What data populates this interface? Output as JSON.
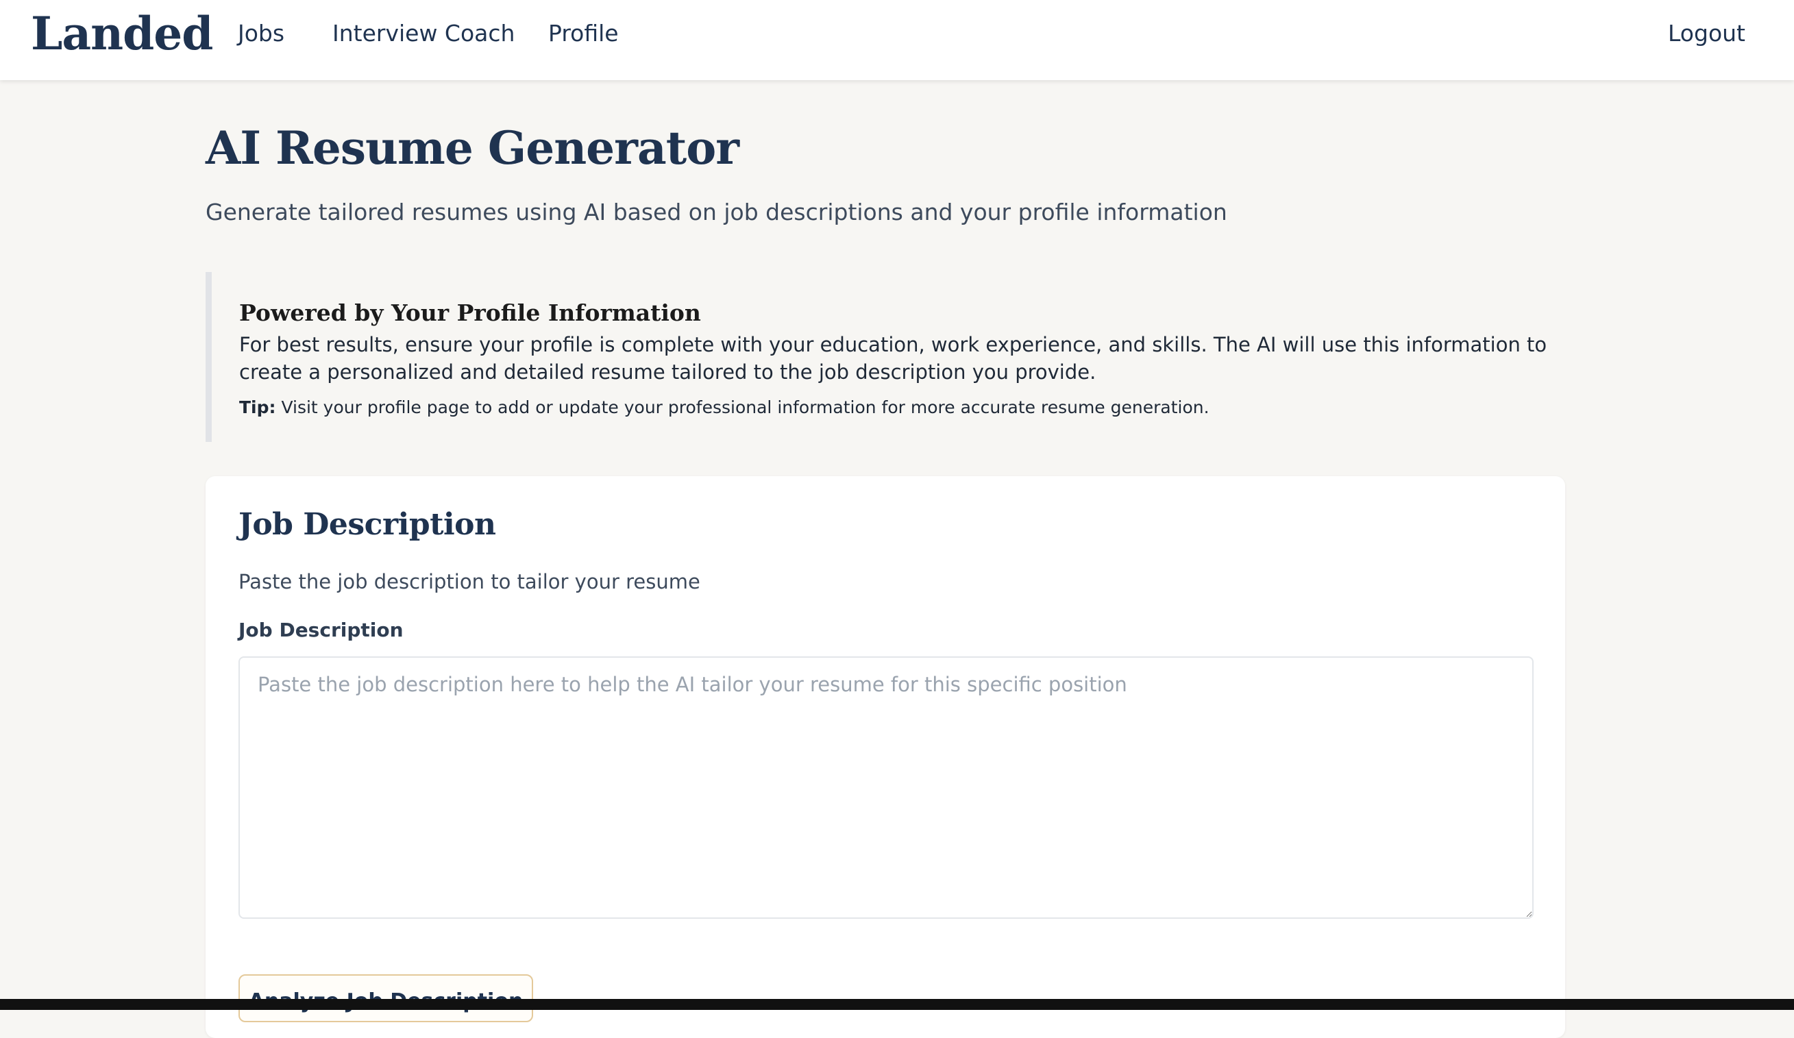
{
  "brand": {
    "logo": "Landed"
  },
  "nav": {
    "links": [
      "Jobs",
      "Interview Coach",
      "Profile"
    ],
    "logout": "Logout"
  },
  "page": {
    "title": "AI Resume Generator",
    "subtitle": "Generate tailored resumes using AI based on job descriptions and your profile information"
  },
  "info": {
    "title": "Powered by Your Profile Information",
    "text": "For best results, ensure your profile is complete with your education, work experience, and skills. The AI will use this information to create a personalized and detailed resume tailored to the job description you provide.",
    "tip_label": "Tip:",
    "tip_text": " Visit your profile page to add or update your professional information for more accurate resume generation."
  },
  "job_card": {
    "title": "Job Description",
    "description": "Paste the job description to tailor your resume",
    "field_label": "Job Description",
    "placeholder": "Paste the job description here to help the AI tailor your resume for this specific position",
    "value": "",
    "button_label": "Analyze Job Description"
  },
  "colors": {
    "navy": "#1f3350",
    "background": "#f7f6f3",
    "button_border": "#e4c99a"
  }
}
